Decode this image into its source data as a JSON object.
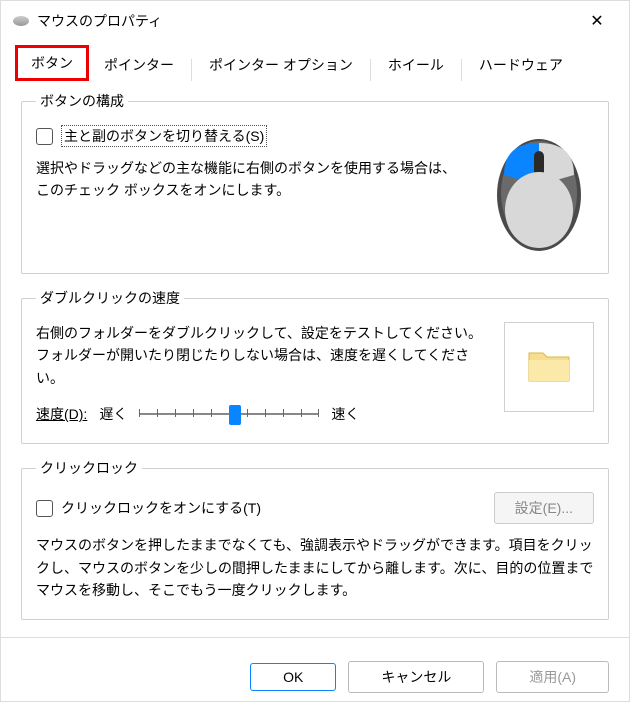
{
  "window": {
    "title": "マウスのプロパティ"
  },
  "tabs": {
    "items": [
      "ボタン",
      "ポインター",
      "ポインター オプション",
      "ホイール",
      "ハードウェア"
    ],
    "activeIndex": 0
  },
  "buttonConfig": {
    "legend": "ボタンの構成",
    "checkboxLabel": "主と副のボタンを切り替える(S)",
    "checkboxChecked": false,
    "description": "選択やドラッグなどの主な機能に右側のボタンを使用する場合は、このチェック ボックスをオンにします。"
  },
  "doubleClick": {
    "legend": "ダブルクリックの速度",
    "description": "右側のフォルダーをダブルクリックして、設定をテストしてください。フォルダーが開いたり閉じたりしない場合は、速度を遅くしてください。",
    "speedLabel": "速度(D):",
    "slowLabel": "遅く",
    "fastLabel": "速く",
    "sliderValue": 0.5
  },
  "clickLock": {
    "legend": "クリックロック",
    "checkboxLabel": "クリックロックをオンにする(T)",
    "checkboxChecked": false,
    "settingsButton": "設定(E)...",
    "description": "マウスのボタンを押したままでなくても、強調表示やドラッグができます。項目をクリックし、マウスのボタンを少しの間押したままにしてから離します。次に、目的の位置までマウスを移動し、そこでもう一度クリックします。"
  },
  "footer": {
    "ok": "OK",
    "cancel": "キャンセル",
    "apply": "適用(A)"
  }
}
